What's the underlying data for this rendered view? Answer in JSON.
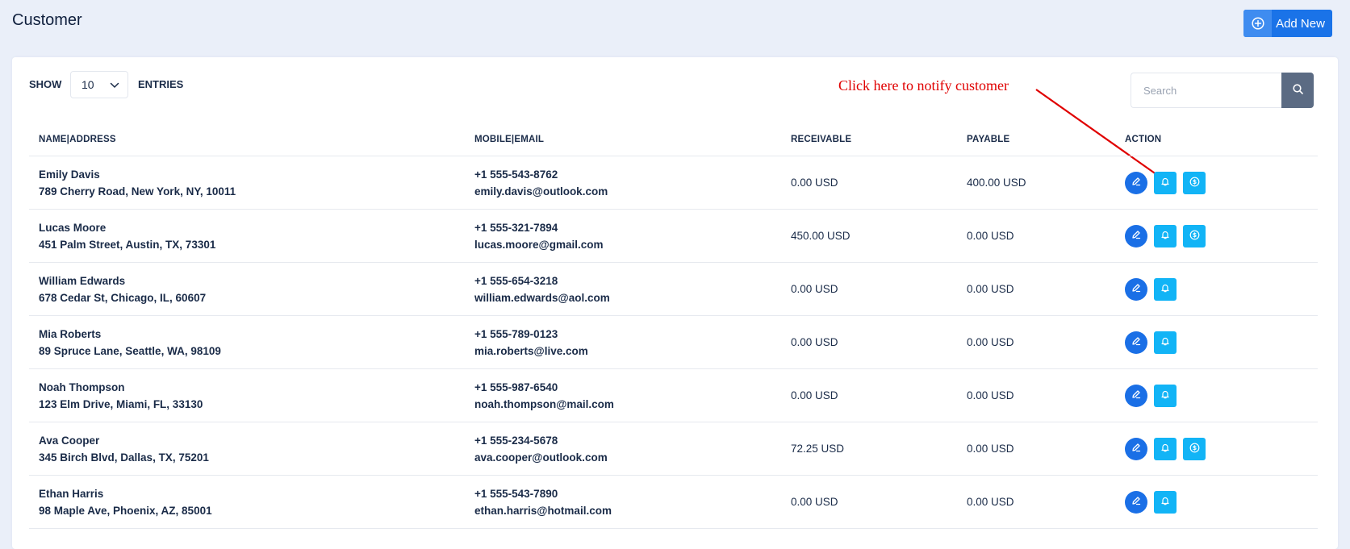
{
  "header": {
    "title": "Customer",
    "add_new_label": "Add New"
  },
  "controls": {
    "show_label": "SHOW",
    "entries_value": "10",
    "entries_label": "ENTRIES",
    "search_placeholder": "Search"
  },
  "annotation": {
    "text": "Click here to notify customer",
    "color": "#e00000"
  },
  "table": {
    "columns": [
      "NAME|ADDRESS",
      "MOBILE|EMAIL",
      "RECEIVABLE",
      "PAYABLE",
      "ACTION"
    ],
    "rows": [
      {
        "name": "Emily Davis",
        "address": "789 Cherry Road, New York, NY, 10011",
        "mobile": "+1 555-543-8762",
        "email": "emily.davis@outlook.com",
        "receivable": "0.00 USD",
        "payable": "400.00 USD",
        "has_payment": true
      },
      {
        "name": "Lucas Moore",
        "address": "451 Palm Street, Austin, TX, 73301",
        "mobile": "+1 555-321-7894",
        "email": "lucas.moore@gmail.com",
        "receivable": "450.00 USD",
        "payable": "0.00 USD",
        "has_payment": true
      },
      {
        "name": "William Edwards",
        "address": "678 Cedar St, Chicago, IL, 60607",
        "mobile": "+1 555-654-3218",
        "email": "william.edwards@aol.com",
        "receivable": "0.00 USD",
        "payable": "0.00 USD",
        "has_payment": false
      },
      {
        "name": "Mia Roberts",
        "address": "89 Spruce Lane, Seattle, WA, 98109",
        "mobile": "+1 555-789-0123",
        "email": "mia.roberts@live.com",
        "receivable": "0.00 USD",
        "payable": "0.00 USD",
        "has_payment": false
      },
      {
        "name": "Noah Thompson",
        "address": "123 Elm Drive, Miami, FL, 33130",
        "mobile": "+1 555-987-6540",
        "email": "noah.thompson@mail.com",
        "receivable": "0.00 USD",
        "payable": "0.00 USD",
        "has_payment": false
      },
      {
        "name": "Ava Cooper",
        "address": "345 Birch Blvd, Dallas, TX, 75201",
        "mobile": "+1 555-234-5678",
        "email": "ava.cooper@outlook.com",
        "receivable": "72.25 USD",
        "payable": "0.00 USD",
        "has_payment": true
      },
      {
        "name": "Ethan Harris",
        "address": "98 Maple Ave, Phoenix, AZ, 85001",
        "mobile": "+1 555-543-7890",
        "email": "ethan.harris@hotmail.com",
        "receivable": "0.00 USD",
        "payable": "0.00 USD",
        "has_payment": false
      }
    ]
  },
  "colors": {
    "background": "#eaeff9",
    "primary": "#1a73e8",
    "edit_button": "#1a6fe6",
    "notify_button": "#12b4f6",
    "search_button": "#5b6b83"
  },
  "icons": {
    "add": "plus-circle-icon",
    "chevron": "chevron-down-icon",
    "search": "search-icon",
    "edit": "pencil-icon",
    "notify": "bell-icon",
    "payment": "dollar-circle-icon"
  }
}
